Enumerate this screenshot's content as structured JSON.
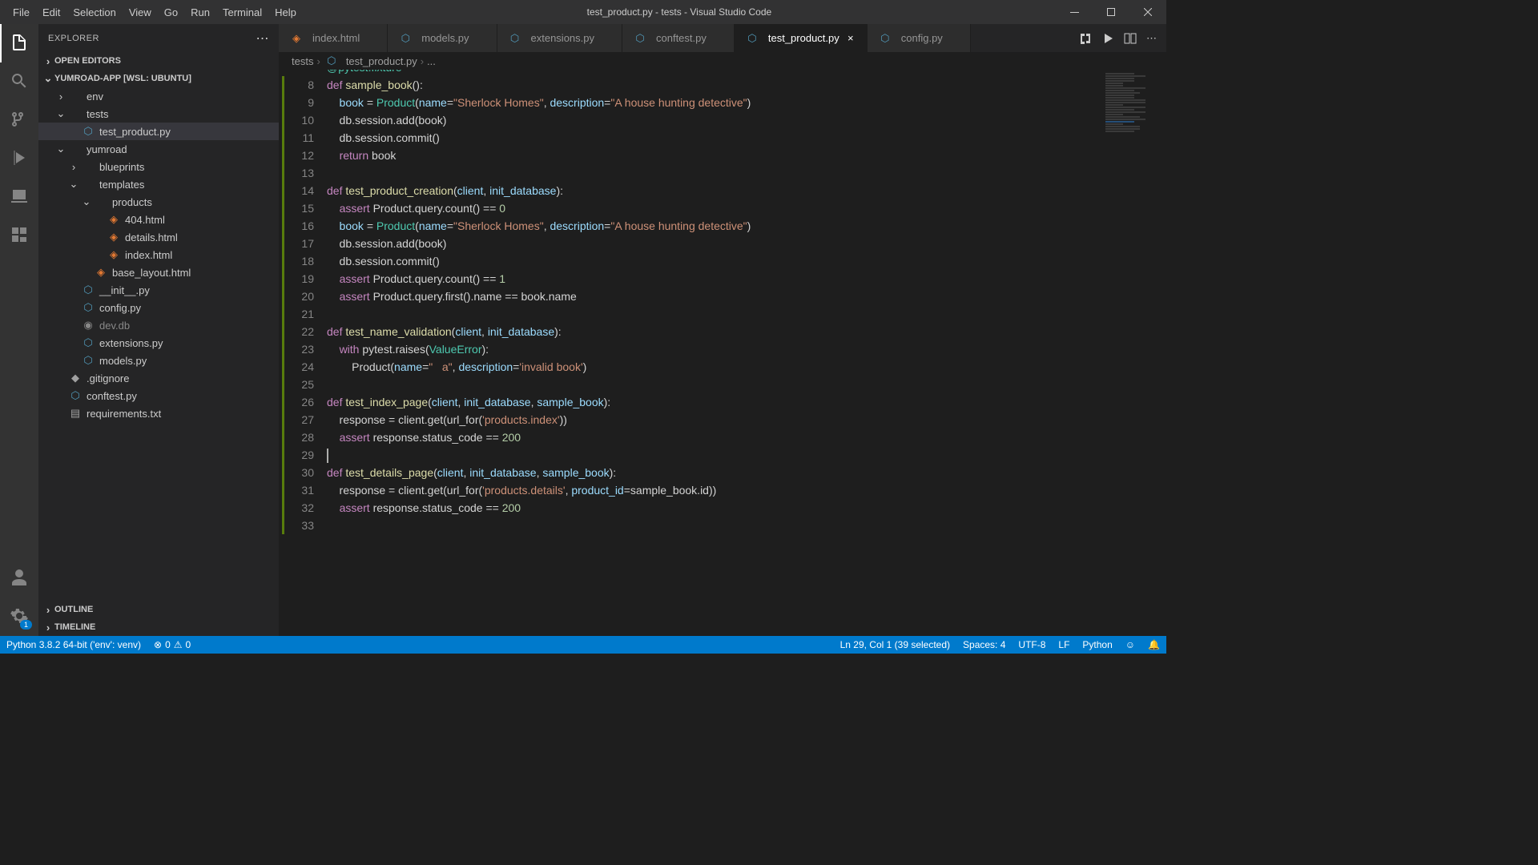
{
  "window": {
    "title": "test_product.py - tests - Visual Studio Code"
  },
  "menu": {
    "file": "File",
    "edit": "Edit",
    "selection": "Selection",
    "view": "View",
    "go": "Go",
    "run": "Run",
    "terminal": "Terminal",
    "help": "Help"
  },
  "sidebar": {
    "title": "EXPLORER",
    "open_editors": "OPEN EDITORS",
    "workspace": "YUMROAD-APP [WSL: UBUNTU]",
    "outline": "OUTLINE",
    "timeline": "TIMELINE",
    "tree": {
      "env": "env",
      "tests": "tests",
      "test_product": "test_product.py",
      "yumroad": "yumroad",
      "blueprints": "blueprints",
      "templates": "templates",
      "products": "products",
      "f404": "404.html",
      "details": "details.html",
      "index_html": "index.html",
      "base_layout": "base_layout.html",
      "init": "__init__.py",
      "config": "config.py",
      "devdb": "dev.db",
      "extensions": "extensions.py",
      "models": "models.py",
      "gitignore": ".gitignore",
      "conftest": "conftest.py",
      "requirements": "requirements.txt"
    }
  },
  "tabs": {
    "index": "index.html",
    "models": "models.py",
    "extensions": "extensions.py",
    "conftest": "conftest.py",
    "test_product": "test_product.py",
    "config": "config.py"
  },
  "breadcrumbs": {
    "tests": "tests",
    "file": "test_product.py",
    "more": "..."
  },
  "code": {
    "lines": [
      {
        "n": 8,
        "tokens": [
          {
            "t": "def ",
            "c": "kw"
          },
          {
            "t": "sample_book",
            "c": "fn"
          },
          {
            "t": "():",
            "c": "pun"
          }
        ]
      },
      {
        "n": 9,
        "tokens": [
          {
            "t": "    book ",
            "c": "var"
          },
          {
            "t": "= ",
            "c": "op"
          },
          {
            "t": "Product",
            "c": "cls"
          },
          {
            "t": "(",
            "c": "pun"
          },
          {
            "t": "name",
            "c": "var"
          },
          {
            "t": "=",
            "c": "op"
          },
          {
            "t": "\"Sherlock Homes\"",
            "c": "str"
          },
          {
            "t": ", ",
            "c": "pun"
          },
          {
            "t": "description",
            "c": "var"
          },
          {
            "t": "=",
            "c": "op"
          },
          {
            "t": "\"A house hunting detective\"",
            "c": "str"
          },
          {
            "t": ")",
            "c": "pun"
          }
        ]
      },
      {
        "n": 10,
        "tokens": [
          {
            "t": "    db.session.add(book)",
            "c": ""
          }
        ]
      },
      {
        "n": 11,
        "tokens": [
          {
            "t": "    db.session.commit()",
            "c": ""
          }
        ]
      },
      {
        "n": 12,
        "tokens": [
          {
            "t": "    ",
            "c": ""
          },
          {
            "t": "return",
            "c": "kw"
          },
          {
            "t": " book",
            "c": ""
          }
        ]
      },
      {
        "n": 13,
        "tokens": []
      },
      {
        "n": 14,
        "tokens": [
          {
            "t": "def ",
            "c": "kw"
          },
          {
            "t": "test_product_creation",
            "c": "fn"
          },
          {
            "t": "(",
            "c": "pun"
          },
          {
            "t": "client",
            "c": "var"
          },
          {
            "t": ", ",
            "c": "pun"
          },
          {
            "t": "init_database",
            "c": "var"
          },
          {
            "t": "):",
            "c": "pun"
          }
        ]
      },
      {
        "n": 15,
        "tokens": [
          {
            "t": "    ",
            "c": ""
          },
          {
            "t": "assert",
            "c": "kw"
          },
          {
            "t": " Product.query.count() == ",
            "c": ""
          },
          {
            "t": "0",
            "c": "num"
          }
        ]
      },
      {
        "n": 16,
        "tokens": [
          {
            "t": "    book ",
            "c": "var"
          },
          {
            "t": "= ",
            "c": "op"
          },
          {
            "t": "Product",
            "c": "cls"
          },
          {
            "t": "(",
            "c": "pun"
          },
          {
            "t": "name",
            "c": "var"
          },
          {
            "t": "=",
            "c": "op"
          },
          {
            "t": "\"Sherlock Homes\"",
            "c": "str"
          },
          {
            "t": ", ",
            "c": "pun"
          },
          {
            "t": "description",
            "c": "var"
          },
          {
            "t": "=",
            "c": "op"
          },
          {
            "t": "\"A house hunting detective\"",
            "c": "str"
          },
          {
            "t": ")",
            "c": "pun"
          }
        ]
      },
      {
        "n": 17,
        "tokens": [
          {
            "t": "    db.session.add(book)",
            "c": ""
          }
        ]
      },
      {
        "n": 18,
        "tokens": [
          {
            "t": "    db.session.commit()",
            "c": ""
          }
        ]
      },
      {
        "n": 19,
        "tokens": [
          {
            "t": "    ",
            "c": ""
          },
          {
            "t": "assert",
            "c": "kw"
          },
          {
            "t": " Product.query.count() == ",
            "c": ""
          },
          {
            "t": "1",
            "c": "num"
          }
        ]
      },
      {
        "n": 20,
        "tokens": [
          {
            "t": "    ",
            "c": ""
          },
          {
            "t": "assert",
            "c": "kw"
          },
          {
            "t": " Product.query.first().name == book.name",
            "c": ""
          }
        ]
      },
      {
        "n": 21,
        "tokens": []
      },
      {
        "n": 22,
        "tokens": [
          {
            "t": "def ",
            "c": "kw"
          },
          {
            "t": "test_name_validation",
            "c": "fn"
          },
          {
            "t": "(",
            "c": "pun"
          },
          {
            "t": "client",
            "c": "var"
          },
          {
            "t": ", ",
            "c": "pun"
          },
          {
            "t": "init_database",
            "c": "var"
          },
          {
            "t": "):",
            "c": "pun"
          }
        ]
      },
      {
        "n": 23,
        "tokens": [
          {
            "t": "    ",
            "c": ""
          },
          {
            "t": "with",
            "c": "kw"
          },
          {
            "t": " pytest.raises(",
            "c": ""
          },
          {
            "t": "ValueError",
            "c": "cls"
          },
          {
            "t": "):",
            "c": "pun"
          }
        ]
      },
      {
        "n": 24,
        "tokens": [
          {
            "t": "        Product(",
            "c": ""
          },
          {
            "t": "name",
            "c": "var"
          },
          {
            "t": "=",
            "c": "op"
          },
          {
            "t": "\"   a\"",
            "c": "str"
          },
          {
            "t": ", ",
            "c": "pun"
          },
          {
            "t": "description",
            "c": "var"
          },
          {
            "t": "=",
            "c": "op"
          },
          {
            "t": "'invalid book'",
            "c": "str"
          },
          {
            "t": ")",
            "c": "pun"
          }
        ]
      },
      {
        "n": 25,
        "tokens": []
      },
      {
        "n": 26,
        "tokens": [
          {
            "t": "def ",
            "c": "kw"
          },
          {
            "t": "test_index_page",
            "c": "fn"
          },
          {
            "t": "(",
            "c": "pun"
          },
          {
            "t": "client",
            "c": "var"
          },
          {
            "t": ", ",
            "c": "pun"
          },
          {
            "t": "init_database",
            "c": "var"
          },
          {
            "t": ", ",
            "c": "pun"
          },
          {
            "t": "sample_book",
            "c": "var"
          },
          {
            "t": "):",
            "c": "pun"
          }
        ]
      },
      {
        "n": 27,
        "tokens": [
          {
            "t": "    response = client.get(url_for(",
            "c": ""
          },
          {
            "t": "'products.index'",
            "c": "str"
          },
          {
            "t": "))",
            "c": "pun"
          }
        ]
      },
      {
        "n": 28,
        "sel": true,
        "tokens": [
          {
            "t": "    ",
            "c": ""
          },
          {
            "t": "assert",
            "c": "kw"
          },
          {
            "t": " response.status_code == ",
            "c": ""
          },
          {
            "t": "200",
            "c": "num"
          }
        ]
      },
      {
        "n": 29,
        "sel": true,
        "cursor": true,
        "tokens": []
      },
      {
        "n": 30,
        "tokens": [
          {
            "t": "def ",
            "c": "kw"
          },
          {
            "t": "test_details_page",
            "c": "fn"
          },
          {
            "t": "(",
            "c": "pun"
          },
          {
            "t": "client",
            "c": "var"
          },
          {
            "t": ", ",
            "c": "pun"
          },
          {
            "t": "init_database",
            "c": "var"
          },
          {
            "t": ", ",
            "c": "pun"
          },
          {
            "t": "sample_book",
            "c": "var"
          },
          {
            "t": "):",
            "c": "pun"
          }
        ]
      },
      {
        "n": 31,
        "tokens": [
          {
            "t": "    response = client.get(url_for(",
            "c": ""
          },
          {
            "t": "'products.details'",
            "c": "str"
          },
          {
            "t": ", ",
            "c": "pun"
          },
          {
            "t": "product_id",
            "c": "var"
          },
          {
            "t": "=sample_book.id))",
            "c": ""
          }
        ]
      },
      {
        "n": 32,
        "tokens": [
          {
            "t": "    ",
            "c": ""
          },
          {
            "t": "assert",
            "c": "kw"
          },
          {
            "t": " response.status_code == ",
            "c": ""
          },
          {
            "t": "200",
            "c": "num"
          }
        ]
      },
      {
        "n": 33,
        "tokens": []
      }
    ],
    "decorator_hint": "@pytest.fixture"
  },
  "status": {
    "python": "Python 3.8.2 64-bit ('env': venv)",
    "errors": "0",
    "warnings": "0",
    "position": "Ln 29, Col 1 (39 selected)",
    "spaces": "Spaces: 4",
    "encoding": "UTF-8",
    "eol": "LF",
    "lang": "Python",
    "feedback": "☺",
    "bell": "🔔"
  },
  "settings_badge": "1"
}
